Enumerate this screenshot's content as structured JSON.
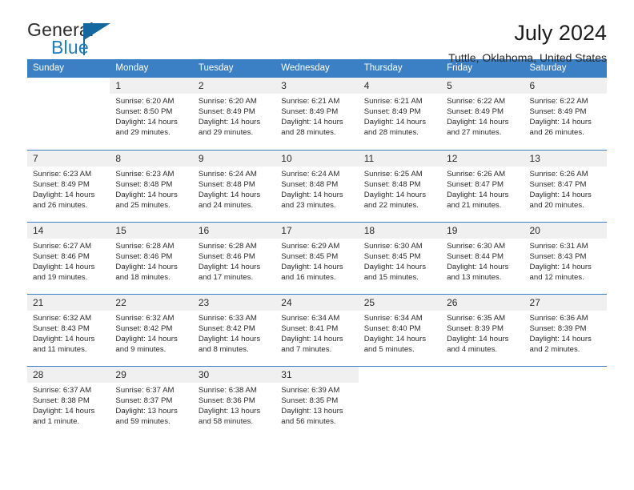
{
  "brand": {
    "word_one": "General",
    "word_two": "Blue",
    "flag_icon": "triangle-flag-icon",
    "accent_color": "#14679f",
    "text_color": "#2c2c2c"
  },
  "header": {
    "title": "July 2024",
    "location": "Tuttle, Oklahoma, United States"
  },
  "calendar": {
    "header_bg": "#3b80c4",
    "header_text_color": "#ffffff",
    "daynum_bg": "#f0f0f0",
    "weekdays": [
      "Sunday",
      "Monday",
      "Tuesday",
      "Wednesday",
      "Thursday",
      "Friday",
      "Saturday"
    ],
    "labels": {
      "sunrise": "Sunrise:",
      "sunset": "Sunset:",
      "daylight": "Daylight:"
    },
    "weeks": [
      [
        {
          "day": "",
          "sunrise": "",
          "sunset": "",
          "daylight_line1": "",
          "daylight_line2": ""
        },
        {
          "day": "1",
          "sunrise": "Sunrise: 6:20 AM",
          "sunset": "Sunset: 8:50 PM",
          "daylight_line1": "Daylight: 14 hours",
          "daylight_line2": "and 29 minutes."
        },
        {
          "day": "2",
          "sunrise": "Sunrise: 6:20 AM",
          "sunset": "Sunset: 8:49 PM",
          "daylight_line1": "Daylight: 14 hours",
          "daylight_line2": "and 29 minutes."
        },
        {
          "day": "3",
          "sunrise": "Sunrise: 6:21 AM",
          "sunset": "Sunset: 8:49 PM",
          "daylight_line1": "Daylight: 14 hours",
          "daylight_line2": "and 28 minutes."
        },
        {
          "day": "4",
          "sunrise": "Sunrise: 6:21 AM",
          "sunset": "Sunset: 8:49 PM",
          "daylight_line1": "Daylight: 14 hours",
          "daylight_line2": "and 28 minutes."
        },
        {
          "day": "5",
          "sunrise": "Sunrise: 6:22 AM",
          "sunset": "Sunset: 8:49 PM",
          "daylight_line1": "Daylight: 14 hours",
          "daylight_line2": "and 27 minutes."
        },
        {
          "day": "6",
          "sunrise": "Sunrise: 6:22 AM",
          "sunset": "Sunset: 8:49 PM",
          "daylight_line1": "Daylight: 14 hours",
          "daylight_line2": "and 26 minutes."
        }
      ],
      [
        {
          "day": "7",
          "sunrise": "Sunrise: 6:23 AM",
          "sunset": "Sunset: 8:49 PM",
          "daylight_line1": "Daylight: 14 hours",
          "daylight_line2": "and 26 minutes."
        },
        {
          "day": "8",
          "sunrise": "Sunrise: 6:23 AM",
          "sunset": "Sunset: 8:48 PM",
          "daylight_line1": "Daylight: 14 hours",
          "daylight_line2": "and 25 minutes."
        },
        {
          "day": "9",
          "sunrise": "Sunrise: 6:24 AM",
          "sunset": "Sunset: 8:48 PM",
          "daylight_line1": "Daylight: 14 hours",
          "daylight_line2": "and 24 minutes."
        },
        {
          "day": "10",
          "sunrise": "Sunrise: 6:24 AM",
          "sunset": "Sunset: 8:48 PM",
          "daylight_line1": "Daylight: 14 hours",
          "daylight_line2": "and 23 minutes."
        },
        {
          "day": "11",
          "sunrise": "Sunrise: 6:25 AM",
          "sunset": "Sunset: 8:48 PM",
          "daylight_line1": "Daylight: 14 hours",
          "daylight_line2": "and 22 minutes."
        },
        {
          "day": "12",
          "sunrise": "Sunrise: 6:26 AM",
          "sunset": "Sunset: 8:47 PM",
          "daylight_line1": "Daylight: 14 hours",
          "daylight_line2": "and 21 minutes."
        },
        {
          "day": "13",
          "sunrise": "Sunrise: 6:26 AM",
          "sunset": "Sunset: 8:47 PM",
          "daylight_line1": "Daylight: 14 hours",
          "daylight_line2": "and 20 minutes."
        }
      ],
      [
        {
          "day": "14",
          "sunrise": "Sunrise: 6:27 AM",
          "sunset": "Sunset: 8:46 PM",
          "daylight_line1": "Daylight: 14 hours",
          "daylight_line2": "and 19 minutes."
        },
        {
          "day": "15",
          "sunrise": "Sunrise: 6:28 AM",
          "sunset": "Sunset: 8:46 PM",
          "daylight_line1": "Daylight: 14 hours",
          "daylight_line2": "and 18 minutes."
        },
        {
          "day": "16",
          "sunrise": "Sunrise: 6:28 AM",
          "sunset": "Sunset: 8:46 PM",
          "daylight_line1": "Daylight: 14 hours",
          "daylight_line2": "and 17 minutes."
        },
        {
          "day": "17",
          "sunrise": "Sunrise: 6:29 AM",
          "sunset": "Sunset: 8:45 PM",
          "daylight_line1": "Daylight: 14 hours",
          "daylight_line2": "and 16 minutes."
        },
        {
          "day": "18",
          "sunrise": "Sunrise: 6:30 AM",
          "sunset": "Sunset: 8:45 PM",
          "daylight_line1": "Daylight: 14 hours",
          "daylight_line2": "and 15 minutes."
        },
        {
          "day": "19",
          "sunrise": "Sunrise: 6:30 AM",
          "sunset": "Sunset: 8:44 PM",
          "daylight_line1": "Daylight: 14 hours",
          "daylight_line2": "and 13 minutes."
        },
        {
          "day": "20",
          "sunrise": "Sunrise: 6:31 AM",
          "sunset": "Sunset: 8:43 PM",
          "daylight_line1": "Daylight: 14 hours",
          "daylight_line2": "and 12 minutes."
        }
      ],
      [
        {
          "day": "21",
          "sunrise": "Sunrise: 6:32 AM",
          "sunset": "Sunset: 8:43 PM",
          "daylight_line1": "Daylight: 14 hours",
          "daylight_line2": "and 11 minutes."
        },
        {
          "day": "22",
          "sunrise": "Sunrise: 6:32 AM",
          "sunset": "Sunset: 8:42 PM",
          "daylight_line1": "Daylight: 14 hours",
          "daylight_line2": "and 9 minutes."
        },
        {
          "day": "23",
          "sunrise": "Sunrise: 6:33 AM",
          "sunset": "Sunset: 8:42 PM",
          "daylight_line1": "Daylight: 14 hours",
          "daylight_line2": "and 8 minutes."
        },
        {
          "day": "24",
          "sunrise": "Sunrise: 6:34 AM",
          "sunset": "Sunset: 8:41 PM",
          "daylight_line1": "Daylight: 14 hours",
          "daylight_line2": "and 7 minutes."
        },
        {
          "day": "25",
          "sunrise": "Sunrise: 6:34 AM",
          "sunset": "Sunset: 8:40 PM",
          "daylight_line1": "Daylight: 14 hours",
          "daylight_line2": "and 5 minutes."
        },
        {
          "day": "26",
          "sunrise": "Sunrise: 6:35 AM",
          "sunset": "Sunset: 8:39 PM",
          "daylight_line1": "Daylight: 14 hours",
          "daylight_line2": "and 4 minutes."
        },
        {
          "day": "27",
          "sunrise": "Sunrise: 6:36 AM",
          "sunset": "Sunset: 8:39 PM",
          "daylight_line1": "Daylight: 14 hours",
          "daylight_line2": "and 2 minutes."
        }
      ],
      [
        {
          "day": "28",
          "sunrise": "Sunrise: 6:37 AM",
          "sunset": "Sunset: 8:38 PM",
          "daylight_line1": "Daylight: 14 hours",
          "daylight_line2": "and 1 minute."
        },
        {
          "day": "29",
          "sunrise": "Sunrise: 6:37 AM",
          "sunset": "Sunset: 8:37 PM",
          "daylight_line1": "Daylight: 13 hours",
          "daylight_line2": "and 59 minutes."
        },
        {
          "day": "30",
          "sunrise": "Sunrise: 6:38 AM",
          "sunset": "Sunset: 8:36 PM",
          "daylight_line1": "Daylight: 13 hours",
          "daylight_line2": "and 58 minutes."
        },
        {
          "day": "31",
          "sunrise": "Sunrise: 6:39 AM",
          "sunset": "Sunset: 8:35 PM",
          "daylight_line1": "Daylight: 13 hours",
          "daylight_line2": "and 56 minutes."
        },
        {
          "day": "",
          "sunrise": "",
          "sunset": "",
          "daylight_line1": "",
          "daylight_line2": ""
        },
        {
          "day": "",
          "sunrise": "",
          "sunset": "",
          "daylight_line1": "",
          "daylight_line2": ""
        },
        {
          "day": "",
          "sunrise": "",
          "sunset": "",
          "daylight_line1": "",
          "daylight_line2": ""
        }
      ]
    ]
  }
}
